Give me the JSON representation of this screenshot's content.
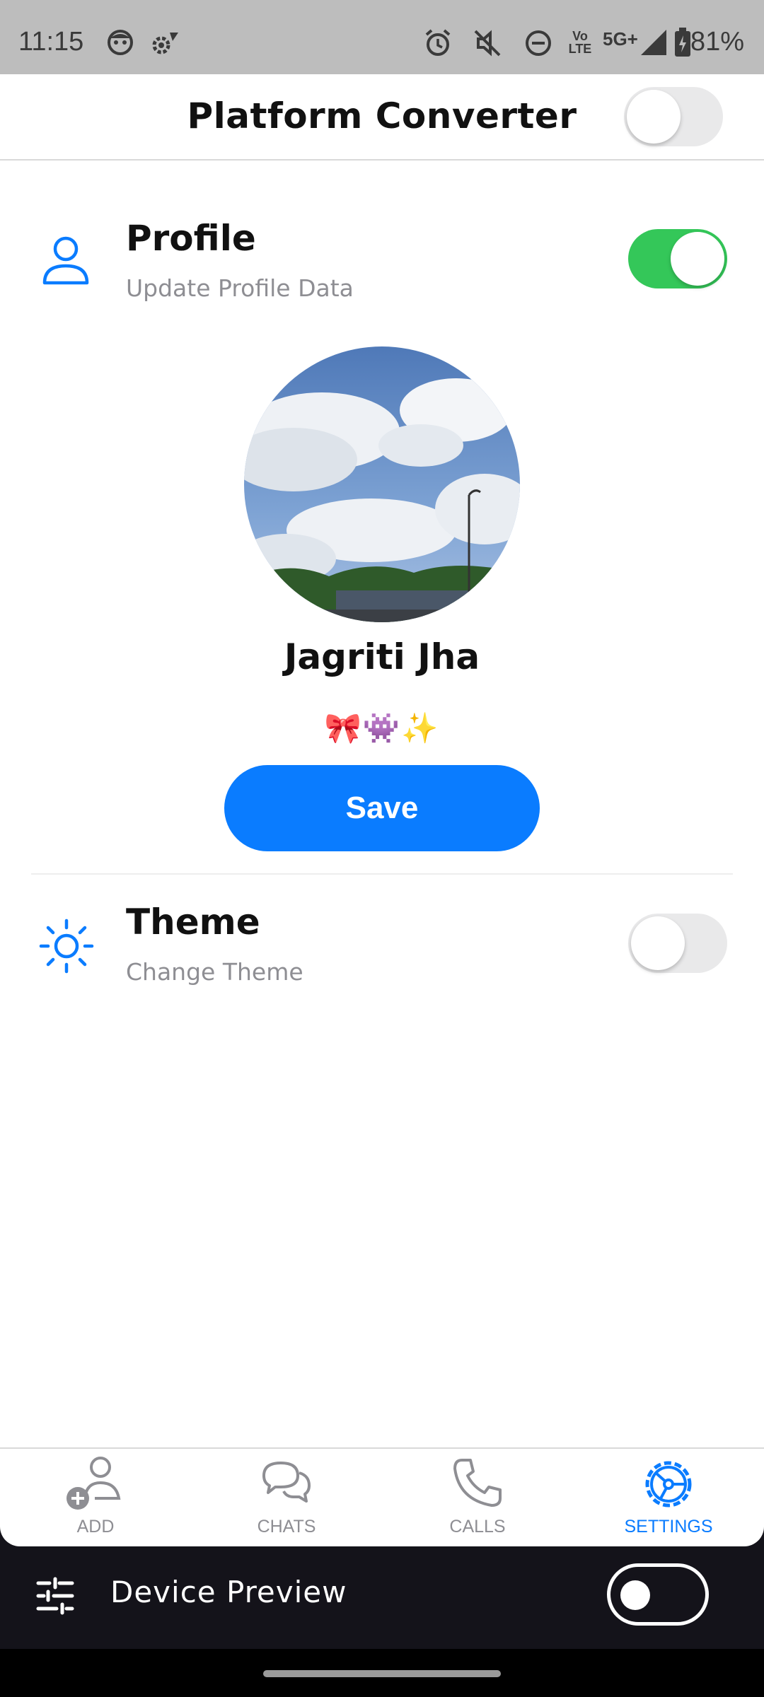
{
  "status_bar": {
    "time": "11:15",
    "network": "5G+",
    "volte": "Vo LTE",
    "battery": "81%",
    "icons": [
      "face-icon",
      "settings-dot-icon",
      "alarm-icon",
      "mute-icon",
      "dnd-icon",
      "signal-icon",
      "battery-icon"
    ]
  },
  "app_bar": {
    "title": "Platform Converter",
    "toggle_on": false
  },
  "profile": {
    "title": "Profile",
    "subtitle": "Update Profile Data",
    "toggle_on": true,
    "name": "Jagriti Jha",
    "bio": "🎀👾✨",
    "save_label": "Save"
  },
  "theme": {
    "title": "Theme",
    "subtitle": "Change Theme",
    "toggle_on": false
  },
  "bottom_nav": {
    "items": [
      {
        "label": "ADD",
        "icon": "add-user-icon",
        "active": false
      },
      {
        "label": "CHATS",
        "icon": "chats-icon",
        "active": false
      },
      {
        "label": "CALLS",
        "icon": "phone-icon",
        "active": false
      },
      {
        "label": "SETTINGS",
        "icon": "settings-gear-icon",
        "active": true
      }
    ]
  },
  "device_preview": {
    "label": "Device Preview",
    "toggle_on": false
  },
  "colors": {
    "accent": "#0a7cff",
    "toggle_on": "#34c759",
    "subtitle": "#8e8e93"
  }
}
